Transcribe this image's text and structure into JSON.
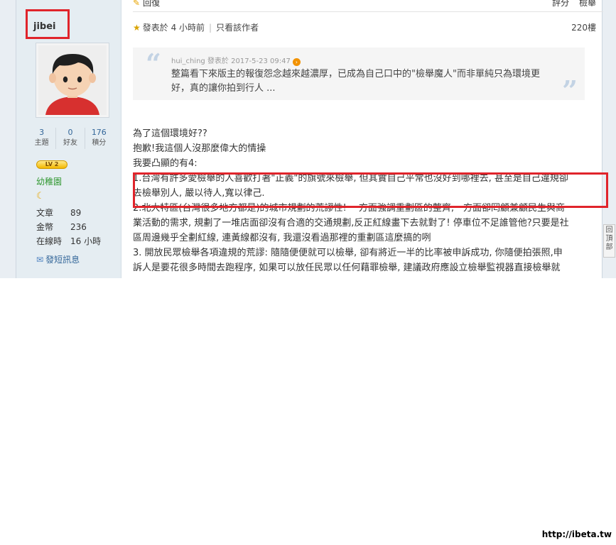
{
  "prev_post": {
    "reply_label": "回復",
    "rate_label": "評分",
    "report_label": "檢舉"
  },
  "author": {
    "name": "jibei",
    "stats": [
      {
        "value": "3",
        "label": "主題"
      },
      {
        "value": "0",
        "label": "好友"
      },
      {
        "value": "176",
        "label": "積分"
      }
    ],
    "level_badge": "LV 2",
    "rank": "幼稚園",
    "info": [
      {
        "label": "文章",
        "value": "89"
      },
      {
        "label": "金幣",
        "value": "236"
      },
      {
        "label": "在線時",
        "value": "16 小時"
      }
    ],
    "pm_label": "發短訊息"
  },
  "post": {
    "posted": "發表於 4 小時前",
    "only_author": "只看該作者",
    "floor": "220樓",
    "quote": {
      "meta": "hui_ching 發表於 2017-5-23 09:47",
      "text": "整篇看下來版主的報復怨念越來越濃厚，已成為自己口中的\"檢舉魔人\"而非單純只為環境更好，真的讓你拍到行人 ..."
    },
    "lines": [
      "為了這個環境好??",
      "抱歉!我這個人沒那麼偉大的情操",
      "我要凸顯的有4:",
      "1.台灣有許多愛檢舉的人喜歡打著\"正義\"的旗號來檢舉, 但其實自己平常也沒好到哪裡去, 甚至是自己違規卻",
      "去檢舉別人, 嚴以待人,寬以律己.",
      "2.北大特區(台灣很多地方都是)的城市規劃的荒謬性! 一方面強調重劃區的整齊,一方面卻罔顧兼顧民生與商",
      "業活動的需求, 規劃了一堆店面卻沒有合適的交通規劃,反正紅線畫下去就對了! 停車位不足誰管他?只要是社",
      "區周邊幾乎全劃紅線, 連黃線都沒有, 我還沒看過那裡的重劃區這麼搞的咧",
      "3. 開放民眾檢舉各項違規的荒謬: 隨隨便便就可以檢舉, 卻有將近一半的比率被申訴成功, 你隨便拍張照,申",
      "訴人是要花很多時間去跑程序, 如果可以放任民眾以任何藉罪檢舉, 建議政府應設立檢舉監視器直接檢舉就"
    ]
  },
  "back_to_top": "回頂部",
  "watermark": "http://ibeta.tw"
}
